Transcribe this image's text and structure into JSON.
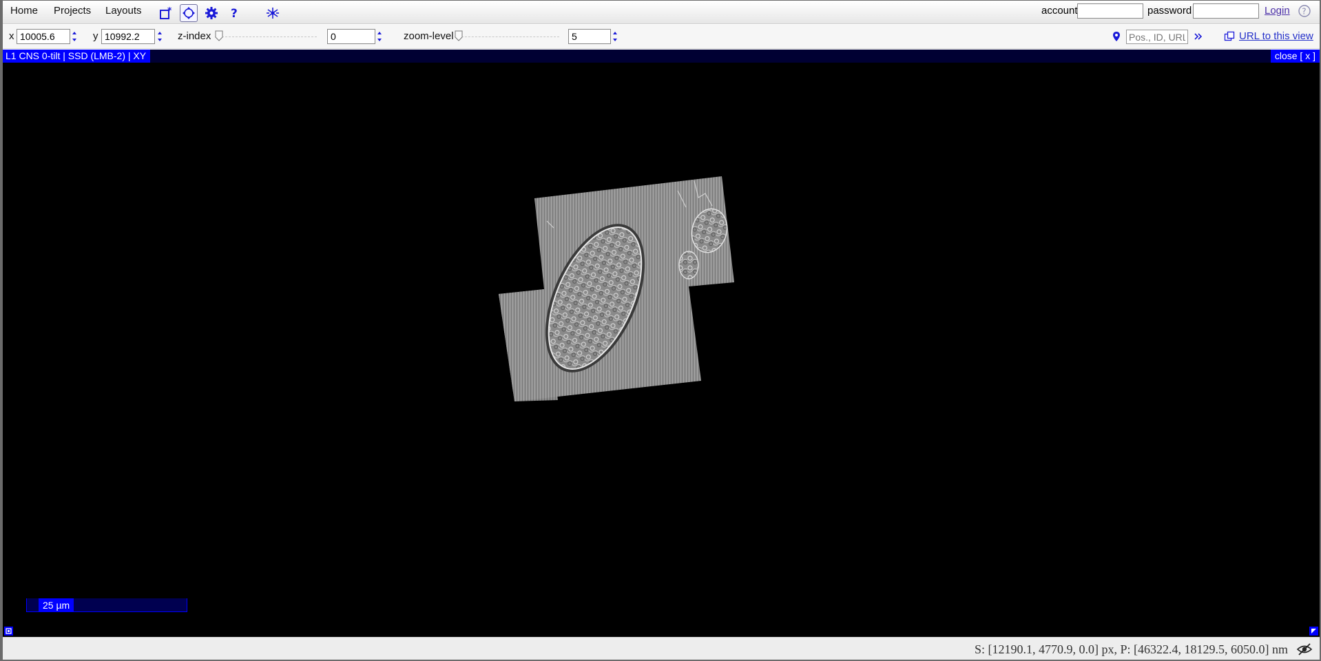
{
  "menu": {
    "home": "Home",
    "projects": "Projects",
    "layouts": "Layouts",
    "tools": [
      {
        "icon": "new-window-icon"
      },
      {
        "icon": "navigate-icon",
        "active": true
      },
      {
        "icon": "settings-gear-icon"
      },
      {
        "icon": "help-question-icon"
      },
      {
        "icon": "neuron-tracing-icon"
      }
    ]
  },
  "login": {
    "account_label": "account",
    "account_value": "",
    "password_label": "password",
    "password_value": "",
    "login_link": "Login",
    "help_icon": "help-circle-icon"
  },
  "toolbar": {
    "x_label": "x",
    "x_value": "10005.6",
    "y_label": "y",
    "y_value": "10992.2",
    "z_label": "z-index",
    "z_value": "0",
    "zoom_label": "zoom-level",
    "zoom_value": "5",
    "search_placeholder": "Pos., ID, URL",
    "url_link": "URL to this view",
    "colors": {
      "accent": "#0000ff",
      "link": "#2430c9",
      "login_link": "#4b2fa8"
    }
  },
  "viewer": {
    "title": "L1 CNS 0-tilt | SSD (LMB-2) | XY",
    "close": "close [ x ]",
    "scalebar": "25 µm",
    "colors": {
      "title_bg": "#0000ff",
      "canvas_bg": "#000000"
    }
  },
  "status": {
    "text": "S: [12190.1, 4770.9, 0.0] px, P: [46322.4, 18129.5, 6050.0] nm",
    "icon": "hidden-eye-icon"
  }
}
